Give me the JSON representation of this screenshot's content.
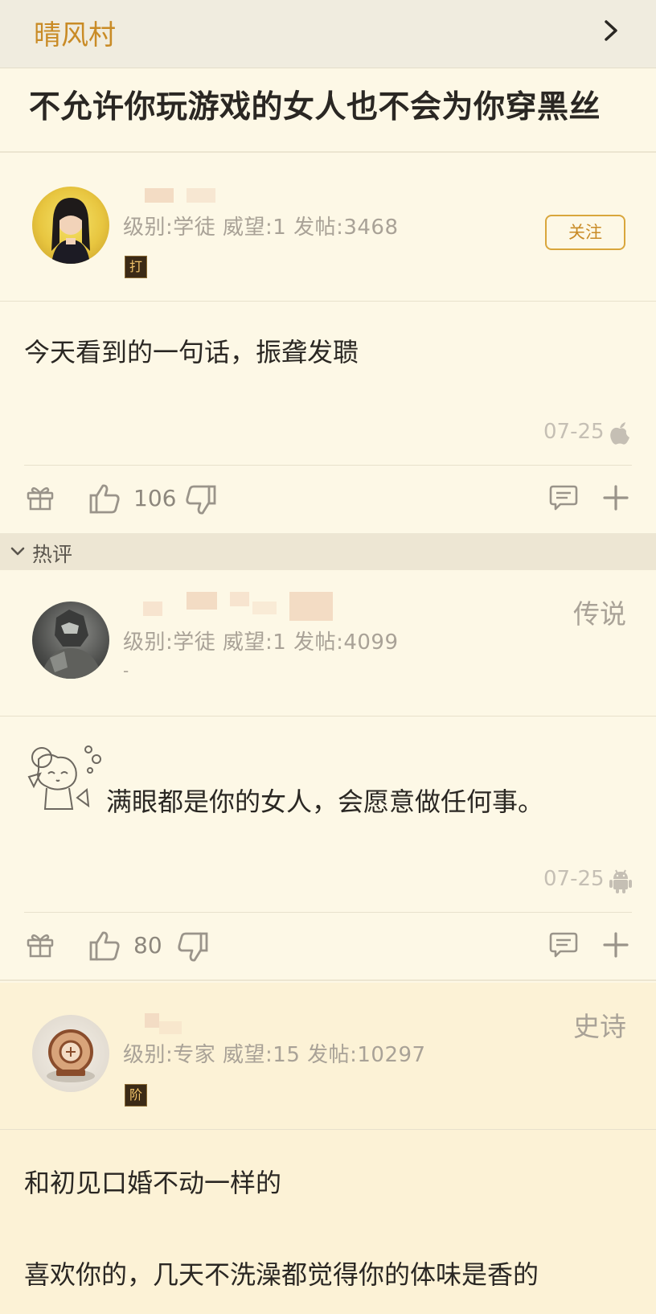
{
  "header": {
    "forum_name": "晴风村",
    "post_title": "不允许你玩游戏的女人也不会为你穿黑丝"
  },
  "main_post": {
    "meta": "级别:学徒  威望:1  发帖:3468",
    "badge": "打",
    "follow_label": "关注",
    "content": "今天看到的一句话，振聋发聩",
    "date": "07-25",
    "platform_icon": "apple-icon",
    "like_count": "106"
  },
  "hot_comments": {
    "label": "热评"
  },
  "comments": [
    {
      "rank": "传说",
      "meta": "级别:学徒  威望:1  发帖:4099",
      "sub": "-",
      "content": "满眼都是你的女人，会愿意做任何事。",
      "date": "07-25",
      "platform_icon": "android-icon",
      "like_count": "80"
    },
    {
      "rank": "史诗",
      "meta": "级别:专家  威望:15  发帖:10297",
      "badge": "阶",
      "content_line1": "和初见口婚不动一样的",
      "content_line2": "喜欢你的，几天不洗澡都觉得你的体味是香的"
    }
  ],
  "colors": {
    "accent": "#c98b26",
    "background": "#fdf8e6",
    "header_bg": "#f0ecdf",
    "muted_text": "#a9a297"
  }
}
